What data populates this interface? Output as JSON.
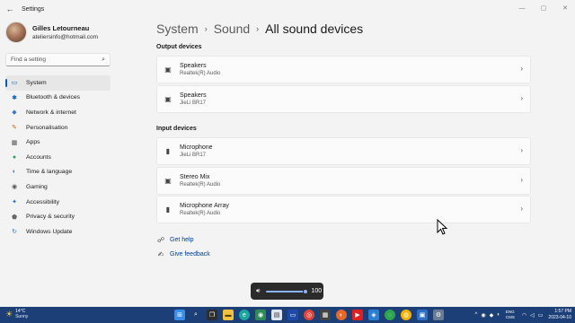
{
  "window": {
    "title": "Settings",
    "controls": [
      "—",
      "▢",
      "✕"
    ]
  },
  "profile": {
    "name": "Gilles Letourneau",
    "email": "ateliersinfo@hotmail.com"
  },
  "search": {
    "placeholder": "Find a setting"
  },
  "nav": [
    {
      "label": "System",
      "icon": "▭",
      "color": "#005fb8",
      "selected": true
    },
    {
      "label": "Bluetooth & devices",
      "icon": "✱",
      "color": "#005fb8"
    },
    {
      "label": "Network & internet",
      "icon": "◆",
      "color": "#3a78c9"
    },
    {
      "label": "Personalisation",
      "icon": "✎",
      "color": "#c46b1a"
    },
    {
      "label": "Apps",
      "icon": "▦",
      "color": "#555555"
    },
    {
      "label": "Accounts",
      "icon": "●",
      "color": "#2f9e5b"
    },
    {
      "label": "Time & language",
      "icon": "◐",
      "color": "#1f7fc4"
    },
    {
      "label": "Gaming",
      "icon": "◉",
      "color": "#555555"
    },
    {
      "label": "Accessibility",
      "icon": "✦",
      "color": "#1f6fb5"
    },
    {
      "label": "Privacy & security",
      "icon": "⬟",
      "color": "#666666"
    },
    {
      "label": "Windows Update",
      "icon": "↻",
      "color": "#1f7fc4"
    }
  ],
  "breadcrumb": {
    "level1": "System",
    "level2": "Sound",
    "current": "All sound devices"
  },
  "output": {
    "title": "Output devices",
    "devices": [
      {
        "name": "Speakers",
        "driver": "Realtek(R) Audio",
        "icon": "speaker-icon"
      },
      {
        "name": "Speakers",
        "driver": "JieLi BR17",
        "icon": "speaker-icon"
      }
    ]
  },
  "input": {
    "title": "Input devices",
    "devices": [
      {
        "name": "Microphone",
        "driver": "JieLi BR17",
        "icon": "microphone-icon"
      },
      {
        "name": "Stereo Mix",
        "driver": "Realtek(R) Audio",
        "icon": "speaker-icon"
      },
      {
        "name": "Microphone Array",
        "driver": "Realtek(R) Audio",
        "icon": "microphone-icon"
      }
    ]
  },
  "links": {
    "help": "Get help",
    "feedback": "Give feedback"
  },
  "volume": {
    "value": "100",
    "level": 1.0
  },
  "taskbar": {
    "weather": {
      "temp": "14°C",
      "condition": "Sunny"
    },
    "apps": [
      "start-icon",
      "search-icon",
      "task-view-icon",
      "file-explorer-icon",
      "edge-icon",
      "chrome-icon",
      "settings-icon"
    ],
    "lang": {
      "line1": "ENG",
      "line2": "CMS"
    },
    "clock": {
      "time": "1:57 PM",
      "date": "2023-04-10"
    }
  }
}
